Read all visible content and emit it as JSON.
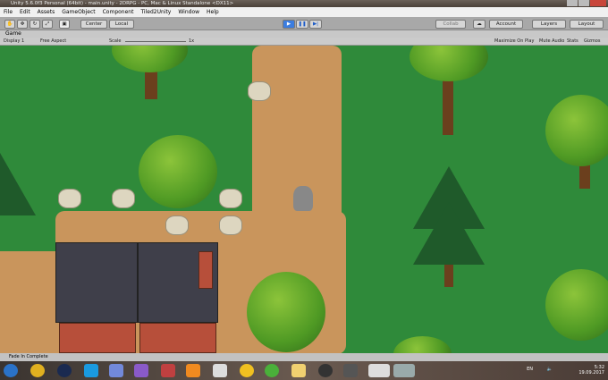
{
  "window": {
    "title": "Unity 5.6.0f3 Personal (64bit) - main.unity - 2DRPG - PC, Mac & Linux Standalone <DX11>"
  },
  "menu": [
    "File",
    "Edit",
    "Assets",
    "GameObject",
    "Component",
    "Tiled2Unity",
    "Window",
    "Help"
  ],
  "toolbar": {
    "center": "Center",
    "local": "Local",
    "collab": "Collab",
    "account": "Account",
    "layers": "Layers",
    "layout": "Layout"
  },
  "game": {
    "tab": "Game",
    "display": "Display 1",
    "aspect": "Free Aspect",
    "scale_label": "Scale",
    "scale_value": "1x",
    "maximize": "Maximize On Play",
    "mute": "Mute Audio",
    "stats": "Stats",
    "gizmos": "Gizmos"
  },
  "status": "Fade In Complete",
  "taskbar": {
    "lang": "EN",
    "time": "5:32",
    "date": "19.09.2017"
  }
}
